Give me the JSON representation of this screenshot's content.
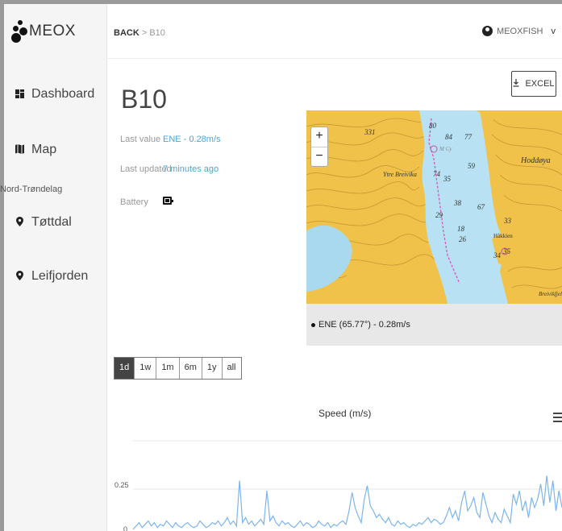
{
  "app": {
    "brand": "MEOX"
  },
  "sidebar": {
    "items": [
      {
        "label": "Dashboard",
        "icon": "dashboard-icon"
      },
      {
        "label": "Map",
        "icon": "map-icon"
      }
    ],
    "region": "Nord-Trøndelag",
    "locations": [
      {
        "label": "Tøttdal",
        "icon": "map-marker-icon"
      },
      {
        "label": "Leifjorden",
        "icon": "map-marker-icon"
      }
    ]
  },
  "header": {
    "back": "BACK",
    "separator": ">",
    "current": "B10",
    "user": "MEOXFISH",
    "user_chevron": "v"
  },
  "main": {
    "title": "B10",
    "excel_label": "EXCEL",
    "excel_icon": "download-icon",
    "last_value_label": "Last value",
    "last_value": "ENE - 0.28m/s",
    "last_updated_label": "Last updated",
    "last_updated": "7 minutes ago",
    "battery_label": "Battery",
    "battery_icon": "battery-icon"
  },
  "map": {
    "zoom_in": "+",
    "zoom_out": "−",
    "caption": "ENE (65.77°) - 0.28m/s",
    "labels": [
      "Ytre Breivika",
      "Hoddøya",
      "Håkkien",
      "Breivikfjellet",
      "M Cy"
    ],
    "numbers": [
      "331",
      "84",
      "77",
      "59",
      "74",
      "35",
      "38",
      "67",
      "29",
      "18",
      "26",
      "33",
      "34",
      "35",
      "80"
    ]
  },
  "range_buttons": [
    "1d",
    "1w",
    "1m",
    "6m",
    "1y",
    "all"
  ],
  "range_active": "1d",
  "chart_data": {
    "type": "line",
    "title": "Speed (m/s)",
    "ytick_labels": [
      "0.25",
      "0"
    ],
    "ylim": [
      0,
      0.4
    ],
    "color": "#7cb5ec",
    "values": [
      0.01,
      0.03,
      0.05,
      0.02,
      0.04,
      0.06,
      0.03,
      0.05,
      0.02,
      0.04,
      0.03,
      0.06,
      0.04,
      0.02,
      0.05,
      0.03,
      0.02,
      0.04,
      0.05,
      0.03,
      0.02,
      0.03,
      0.06,
      0.04,
      0.02,
      0.03,
      0.05,
      0.04,
      0.06,
      0.03,
      0.05,
      0.08,
      0.04,
      0.06,
      0.03,
      0.3,
      0.05,
      0.08,
      0.04,
      0.06,
      0.03,
      0.05,
      0.07,
      0.04,
      0.24,
      0.06,
      0.09,
      0.05,
      0.03,
      0.06,
      0.04,
      0.05,
      0.03,
      0.02,
      0.04,
      0.06,
      0.03,
      0.05,
      0.04,
      0.02,
      0.03,
      0.06,
      0.04,
      0.03,
      0.05,
      0.02,
      0.04,
      0.03,
      0.05,
      0.06,
      0.04,
      0.12,
      0.23,
      0.14,
      0.09,
      0.05,
      0.19,
      0.27,
      0.15,
      0.12,
      0.08,
      0.1,
      0.07,
      0.05,
      0.08,
      0.04,
      0.03,
      0.06,
      0.04,
      0.05,
      0.03,
      0.02,
      0.04,
      0.03,
      0.05,
      0.04,
      0.06,
      0.08,
      0.05,
      0.07,
      0.06,
      0.04,
      0.05,
      0.09,
      0.14,
      0.08,
      0.12,
      0.06,
      0.17,
      0.24,
      0.12,
      0.15,
      0.2,
      0.11,
      0.08,
      0.23,
      0.16,
      0.09,
      0.05,
      0.11,
      0.07,
      0.05,
      0.13,
      0.09,
      0.05,
      0.22,
      0.16,
      0.24,
      0.12,
      0.18,
      0.08,
      0.2,
      0.14,
      0.19,
      0.28,
      0.15,
      0.33,
      0.17,
      0.3,
      0.12,
      0.24,
      0.14
    ]
  }
}
